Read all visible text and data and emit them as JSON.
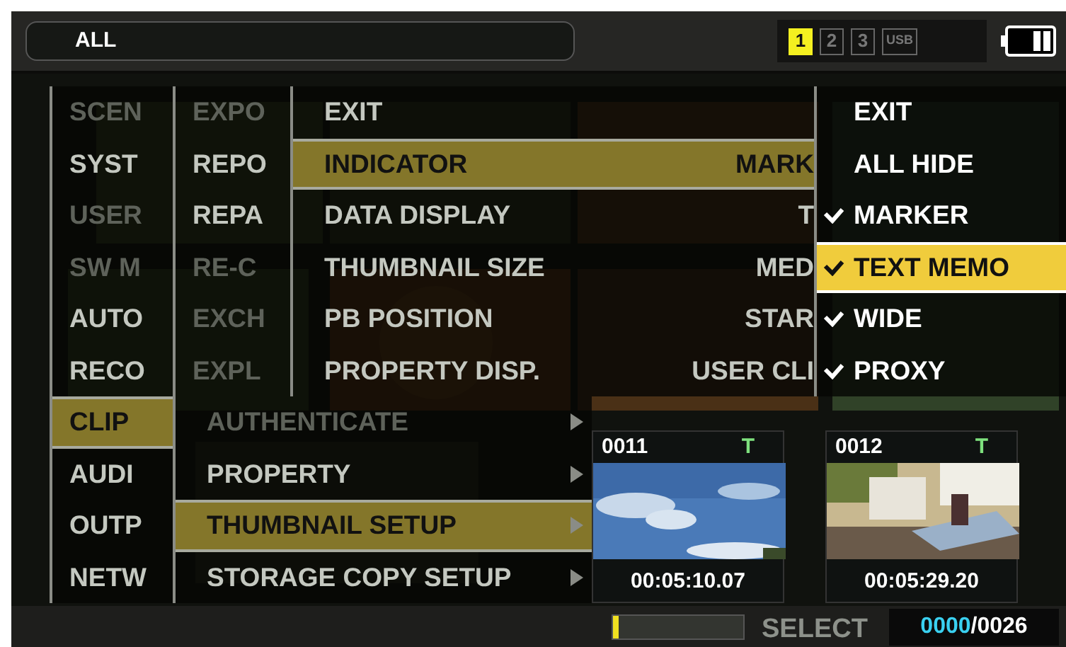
{
  "top_bar": {
    "filter": "ALL",
    "slots": [
      {
        "label": "1",
        "selected": true
      },
      {
        "label": "2",
        "selected": false
      },
      {
        "label": "3",
        "selected": false
      },
      {
        "label": "USB",
        "selected": false
      }
    ]
  },
  "thumbnails": [
    {
      "number": "0011",
      "flag": "T",
      "timecode": "00:05:10.07"
    },
    {
      "number": "0012",
      "flag": "T",
      "timecode": "00:05:29.20"
    }
  ],
  "menus": [
    {
      "items": [
        {
          "label": "SCEN",
          "selected": false,
          "disabled": true
        },
        {
          "label": "SYST",
          "selected": false,
          "disabled": false
        },
        {
          "label": "USER",
          "selected": false,
          "disabled": true
        },
        {
          "label": "SW M",
          "selected": false,
          "disabled": true
        },
        {
          "label": "AUTO",
          "selected": false,
          "disabled": false
        },
        {
          "label": "RECO",
          "selected": false,
          "disabled": false
        },
        {
          "label": "CLIP",
          "selected": true,
          "disabled": false
        },
        {
          "label": "AUDI",
          "selected": false,
          "disabled": false
        },
        {
          "label": "OUTP",
          "selected": false,
          "disabled": false
        },
        {
          "label": "NETW",
          "selected": false,
          "disabled": false
        }
      ]
    },
    {
      "items": [
        {
          "label": "EXPO",
          "selected": false,
          "disabled": true
        },
        {
          "label": "REPO",
          "selected": false,
          "disabled": false
        },
        {
          "label": "REPA",
          "selected": false,
          "disabled": false
        },
        {
          "label": "RE-C",
          "selected": false,
          "disabled": true
        },
        {
          "label": "EXCH",
          "selected": false,
          "disabled": true
        },
        {
          "label": "EXPL",
          "selected": false,
          "disabled": true
        }
      ]
    },
    {
      "items": [
        {
          "label": "AUTHENTICATE",
          "selected": false,
          "disabled": true,
          "submenu": true
        },
        {
          "label": "PROPERTY",
          "selected": false,
          "disabled": false,
          "submenu": true
        },
        {
          "label": "THUMBNAIL SETUP",
          "selected": true,
          "disabled": false,
          "submenu": true
        },
        {
          "label": "STORAGE COPY SETUP",
          "selected": false,
          "disabled": false,
          "submenu": true
        }
      ]
    },
    {
      "items": [
        {
          "label": "EXIT",
          "selected": false,
          "disabled": false
        },
        {
          "label": "INDICATOR",
          "value": "MARK",
          "selected": true,
          "disabled": false
        },
        {
          "label": "DATA DISPLAY",
          "value": "T",
          "selected": false,
          "disabled": false
        },
        {
          "label": "THUMBNAIL SIZE",
          "value": "MED",
          "selected": false,
          "disabled": false
        },
        {
          "label": "PB POSITION",
          "value": "STAR",
          "selected": false,
          "disabled": false
        },
        {
          "label": "PROPERTY DISP.",
          "value": "USER CLI",
          "selected": false,
          "disabled": false
        }
      ]
    },
    {
      "items": [
        {
          "label": "EXIT",
          "selected": false,
          "checked": false
        },
        {
          "label": "ALL HIDE",
          "selected": false,
          "checked": false
        },
        {
          "label": "MARKER",
          "selected": false,
          "checked": true
        },
        {
          "label": "TEXT MEMO",
          "selected": true,
          "checked": true
        },
        {
          "label": "WIDE",
          "selected": false,
          "checked": true
        },
        {
          "label": "PROXY",
          "selected": false,
          "checked": true
        }
      ]
    }
  ],
  "status_bar": {
    "level": 0.04,
    "select_label": "SELECT",
    "selected_count": "0000",
    "total_count": "/0026"
  }
}
